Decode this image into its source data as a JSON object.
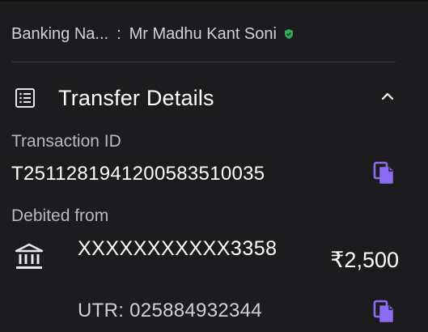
{
  "banking": {
    "label": "Banking Na...",
    "separator": ":",
    "name": "Mr Madhu Kant Soni",
    "verified_icon": "verified-shield-icon"
  },
  "section": {
    "title": "Transfer Details",
    "icon": "list-icon",
    "toggle_icon": "chevron-up-icon"
  },
  "transaction": {
    "label": "Transaction ID",
    "value": "T2511281941200583510035",
    "copy_icon": "copy-icon"
  },
  "debited": {
    "label": "Debited from",
    "bank_icon": "bank-icon",
    "account": "XXXXXXXXXXX3358",
    "amount": "₹2,500",
    "utr": "UTR: 025884932344",
    "copy_icon": "copy-icon"
  },
  "colors": {
    "background": "#1c1c1e",
    "accent": "#8b6cf0",
    "verified": "#2fae5a",
    "secondary_text": "#b9b9be"
  }
}
